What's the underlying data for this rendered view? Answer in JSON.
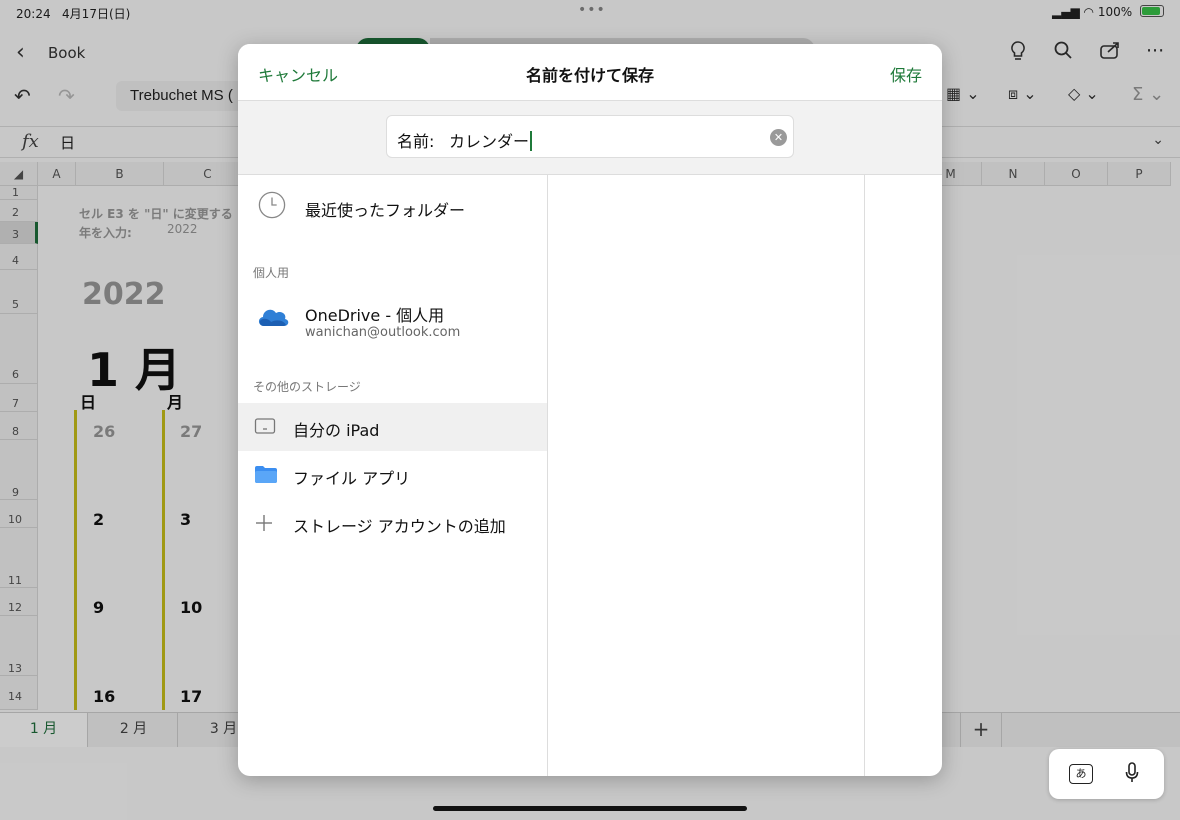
{
  "status": {
    "time": "20:24",
    "date": "4月17日(日)",
    "battery": "100%"
  },
  "app": {
    "back_label": "Book",
    "font_name": "Trebuchet MS (",
    "formula_value": "日",
    "columns": [
      "A",
      "B",
      "C",
      "M",
      "N",
      "O",
      "P"
    ],
    "rows": [
      "1",
      "2",
      "3",
      "4",
      "5",
      "6",
      "7",
      "8",
      "9",
      "10",
      "11",
      "12",
      "13",
      "14"
    ],
    "note1": "セル E3 を \"日\" に変更する",
    "note2": "年を入力:",
    "year_input": "2022",
    "year_big": "2022",
    "month_big": "1 月",
    "day_sun": "日",
    "day_mon": "月",
    "dates": {
      "d26": "26",
      "d27": "27",
      "d2": "2",
      "d3": "3",
      "d9": "9",
      "d10": "10",
      "d16": "16",
      "d17": "17"
    },
    "sheet_tabs": [
      "1 月",
      "2 月",
      "3 月"
    ],
    "add_sheet": "+"
  },
  "keyboard": {
    "ime_key": "あ"
  },
  "dialog": {
    "cancel": "キャンセル",
    "title": "名前を付けて保存",
    "save": "保存",
    "name_label": "名前:",
    "name_value": "カレンダー",
    "recent": "最近使ったフォルダー",
    "section_personal": "個人用",
    "onedrive_title": "OneDrive - 個人用",
    "onedrive_account": "wanichan@outlook.com",
    "section_other": "その他のストレージ",
    "my_ipad": "自分の iPad",
    "files_app": "ファイル アプリ",
    "add_account": "ストレージ アカウントの追加"
  },
  "colors": {
    "accent": "#1f7a3a",
    "folder": "#3b8ef0",
    "calendar_line": "#c9c01a"
  }
}
